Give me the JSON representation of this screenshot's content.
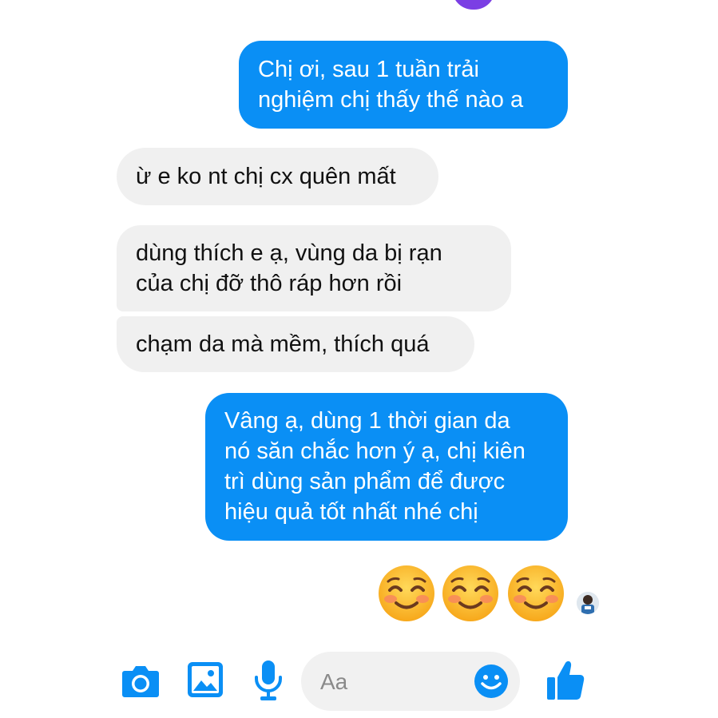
{
  "messages": [
    {
      "id": "m1",
      "direction": "out",
      "text": "Chị ơi, sau 1 tuần trải\nnghiệm chị thấy thế nào a"
    },
    {
      "id": "m2",
      "direction": "in",
      "text": "ừ e ko nt chị cx quên mất"
    },
    {
      "id": "m3",
      "direction": "in",
      "text": "dùng thích e ạ, vùng da bị rạn\ncủa chị đỡ thô ráp hơn rồi"
    },
    {
      "id": "m4",
      "direction": "in",
      "text": "chạm da mà mềm, thích quá"
    },
    {
      "id": "m5",
      "direction": "out",
      "text": "Vâng ạ, dùng 1 thời gian da\nnó săn chắc hơn ý ạ, chị kiên\ntrì dùng sản phẩm để được\nhiệu quả tốt nhất nhé chị"
    }
  ],
  "emoji_message": {
    "emojis": [
      "smiling-face-with-smiling-eyes",
      "smiling-face-with-smiling-eyes",
      "smiling-face-with-smiling-eyes"
    ]
  },
  "composer": {
    "placeholder": "Aa",
    "icons": [
      "camera-icon",
      "gallery-icon",
      "microphone-icon",
      "emoji-icon",
      "thumbs-up-icon"
    ]
  },
  "colors": {
    "outgoing_bubble": "#0a8ff5",
    "incoming_bubble": "#f0f0f0",
    "accent": "#0a8ff5"
  }
}
